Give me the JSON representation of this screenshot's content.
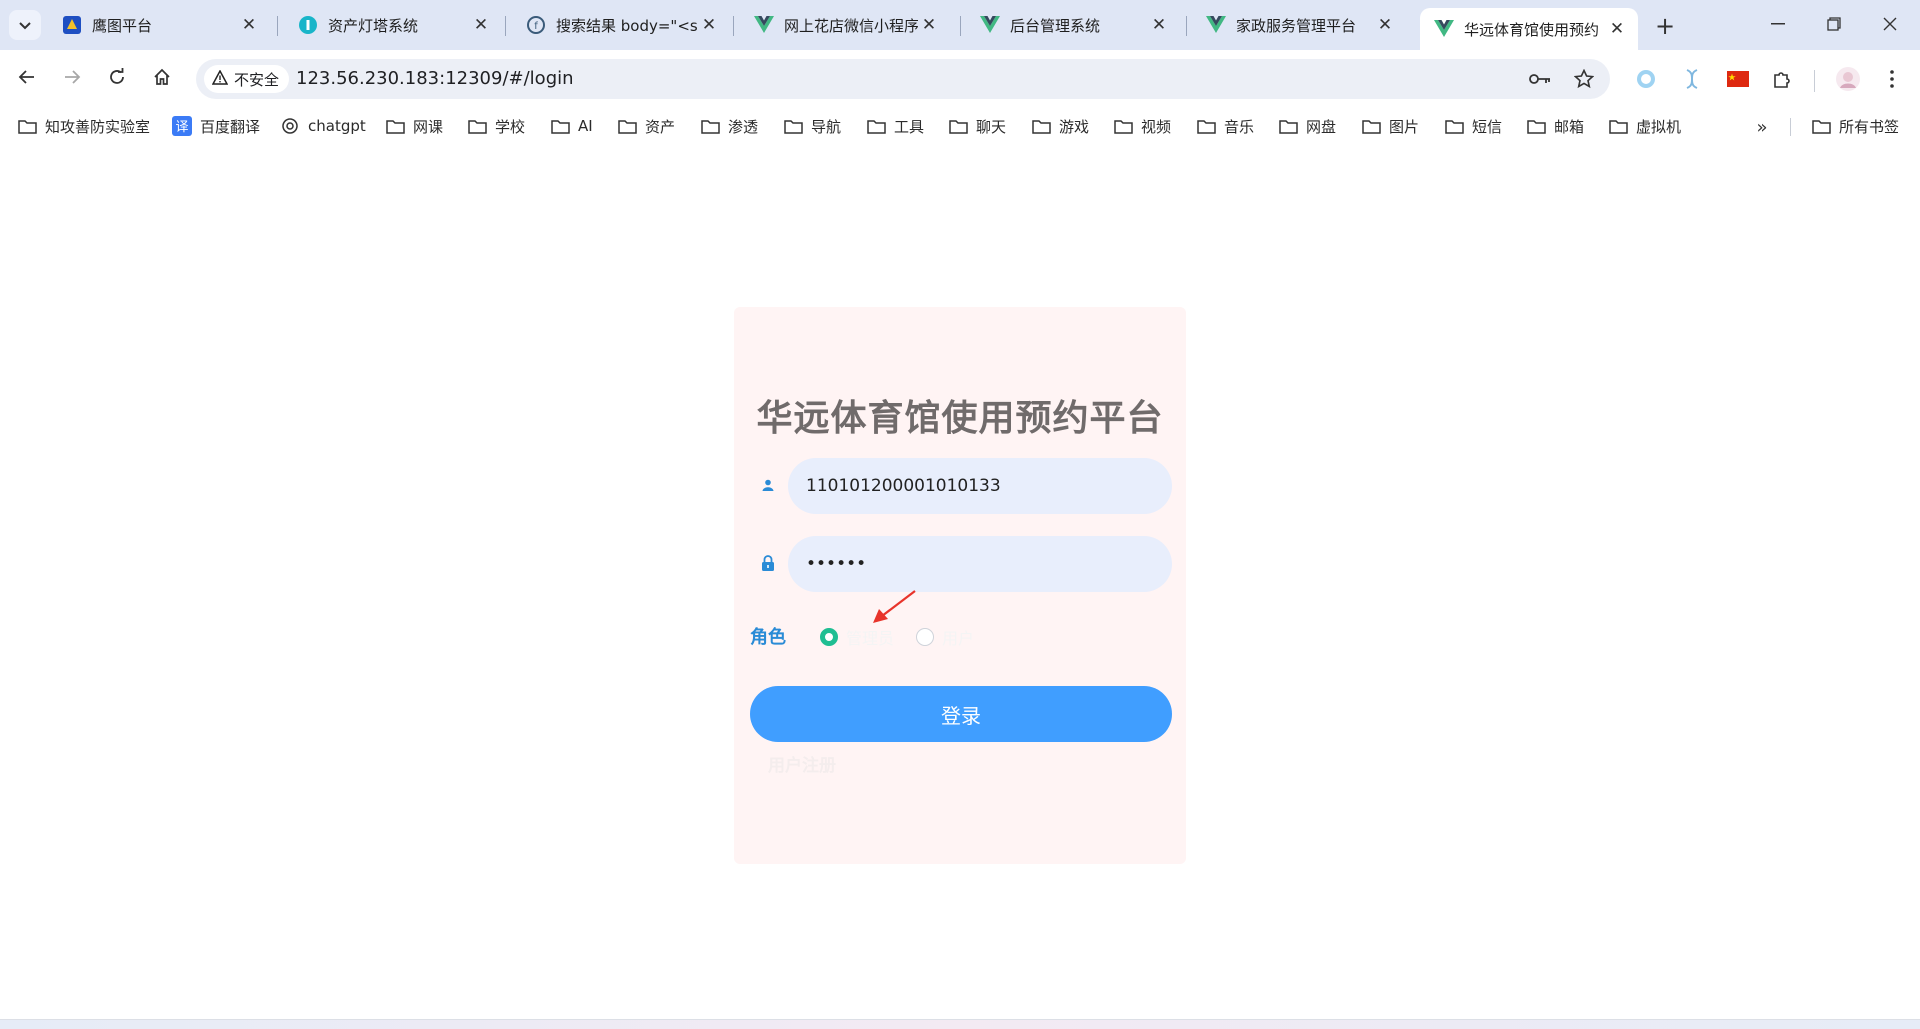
{
  "browser": {
    "tabs": [
      {
        "title": "鹰图平台",
        "icon": "hunter-logo-icon"
      },
      {
        "title": "资产灯塔系统",
        "icon": "lighthouse-logo-icon"
      },
      {
        "title": "搜索结果 body=\"<s",
        "icon": "fofa-logo-icon"
      },
      {
        "title": "网上花店微信小程序",
        "icon": "vue-logo-icon"
      },
      {
        "title": "后台管理系统",
        "icon": "vue-logo-icon"
      },
      {
        "title": "家政服务管理平台",
        "icon": "vue-logo-icon"
      },
      {
        "title": "华远体育馆使用预约",
        "icon": "vue-logo-icon",
        "active": true
      }
    ],
    "security_label": "不安全",
    "url": "123.56.230.183:12309/#/login",
    "bookmarks": [
      {
        "label": "知攻善防实验室",
        "icon": "folder-icon"
      },
      {
        "label": "百度翻译",
        "icon": "translate-icon"
      },
      {
        "label": "chatgpt",
        "icon": "openai-icon"
      },
      {
        "label": "网课",
        "icon": "folder-icon"
      },
      {
        "label": "学校",
        "icon": "folder-icon"
      },
      {
        "label": "AI",
        "icon": "folder-icon"
      },
      {
        "label": "资产",
        "icon": "folder-icon"
      },
      {
        "label": "渗透",
        "icon": "folder-icon"
      },
      {
        "label": "导航",
        "icon": "folder-icon"
      },
      {
        "label": "工具",
        "icon": "folder-icon"
      },
      {
        "label": "聊天",
        "icon": "folder-icon"
      },
      {
        "label": "游戏",
        "icon": "folder-icon"
      },
      {
        "label": "视频",
        "icon": "folder-icon"
      },
      {
        "label": "音乐",
        "icon": "folder-icon"
      },
      {
        "label": "网盘",
        "icon": "folder-icon"
      },
      {
        "label": "图片",
        "icon": "folder-icon"
      },
      {
        "label": "短信",
        "icon": "folder-icon"
      },
      {
        "label": "邮箱",
        "icon": "folder-icon"
      },
      {
        "label": "虚拟机",
        "icon": "folder-icon"
      }
    ],
    "all_bookmarks_label": "所有书签",
    "translate_glyph": "译"
  },
  "login": {
    "title": "华远体育馆使用预约平台",
    "username_value": "110101200001010133",
    "password_value": "••••••",
    "role_label": "角色",
    "roles": [
      {
        "label": "管理员",
        "selected": true
      },
      {
        "label": "用户",
        "selected": false
      }
    ],
    "submit_label": "登录",
    "register_label": "用户注册"
  },
  "colors": {
    "accent": "#409eff",
    "card_bg": "#fff4f4",
    "radio_on": "#1fbe92",
    "role_label": "#2a8bd6",
    "annotation_arrow": "#e8342b"
  }
}
